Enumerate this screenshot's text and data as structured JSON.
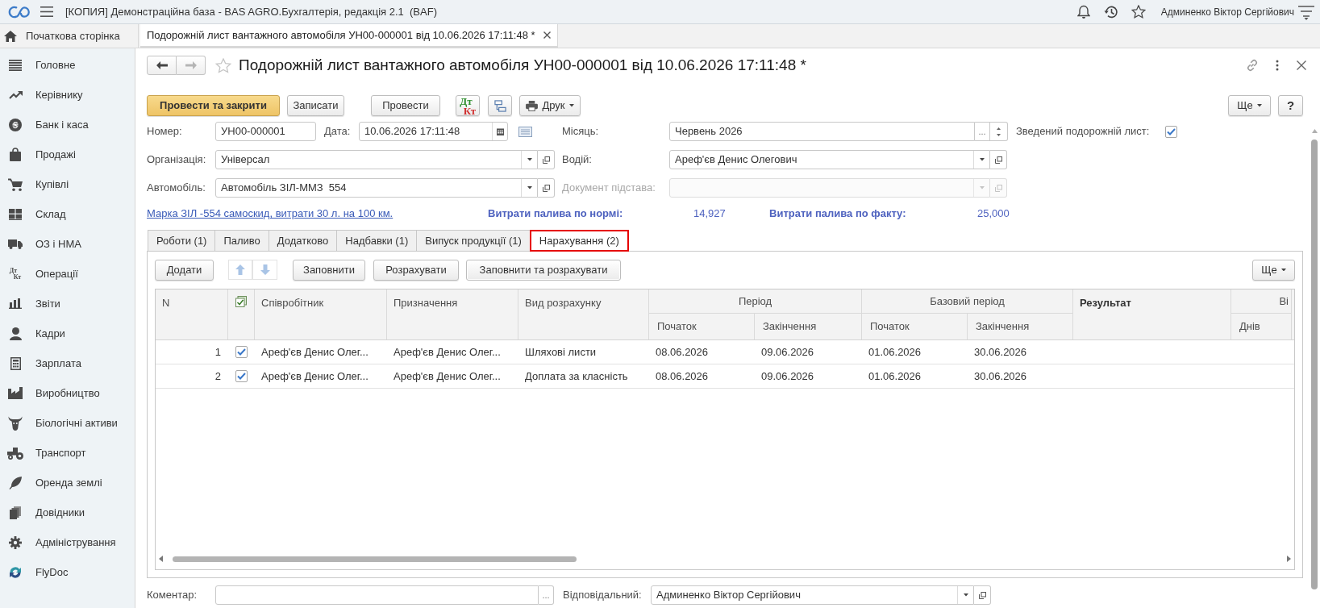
{
  "window": {
    "title": "[КОПИЯ] Демонстраційна база - BAS AGRO.Бухгалтерія, редакція 2.1  (BAF)",
    "user": "Админенко Віктор Сергійович"
  },
  "open_tabs": [
    {
      "kind": "home",
      "label": "Початкова сторінка",
      "selected": false
    },
    {
      "kind": "document",
      "label": "Подорожній лист вантажного автомобіля УН00-000001 від 10.06.2026 17:11:48 *",
      "selected": true
    }
  ],
  "sidebar": {
    "items": [
      {
        "label": "Головне"
      },
      {
        "label": "Керівнику"
      },
      {
        "label": "Банк і каса"
      },
      {
        "label": "Продажі"
      },
      {
        "label": "Купівлі"
      },
      {
        "label": "Склад"
      },
      {
        "label": "ОЗ і НМА"
      },
      {
        "label": "Операції",
        "icon_text": [
          "Дт",
          "Кт"
        ]
      },
      {
        "label": "Звіти"
      },
      {
        "label": "Кадри"
      },
      {
        "label": "Зарплата"
      },
      {
        "label": "Виробництво"
      },
      {
        "label": "Біологічні активи"
      },
      {
        "label": "Транспорт"
      },
      {
        "label": "Оренда землі"
      },
      {
        "label": "Довідники"
      },
      {
        "label": "Адміністрування"
      },
      {
        "label": "FlyDoc"
      }
    ]
  },
  "document": {
    "title": "Подорожній лист вантажного автомобіля УН00-000001 від 10.06.2026 17:11:48 *",
    "commands": [
      {
        "kind": "primary",
        "label": "Провести та закрити"
      },
      {
        "kind": "text",
        "label": "Записати"
      },
      {
        "kind": "text",
        "label": "Провести"
      },
      {
        "kind": "debit_credit",
        "letters": [
          "Дт",
          "Кт"
        ]
      },
      {
        "kind": "structure"
      },
      {
        "kind": "print",
        "label": "Друк"
      }
    ],
    "more": "Ще",
    "help": "?",
    "fields": {
      "number": {
        "label": "Номер:",
        "value": "УН00-000001"
      },
      "date": {
        "label": "Дата:",
        "value": "10.06.2026 17:11:48"
      },
      "month": {
        "label": "Місяць:",
        "value": "Червень 2026",
        "choice_button": "..."
      },
      "summary": {
        "label": "Зведений подорожній лист:",
        "checked": true
      },
      "organization": {
        "label": "Організація:",
        "value": "Універсал",
        "disabled": false
      },
      "driver": {
        "label": "Водій:",
        "value": "Ареф'єв Денис Олегович",
        "disabled": false
      },
      "vehicle": {
        "label": "Автомобіль:",
        "value": "Автомобіль ЗІЛ-ММЗ  554",
        "disabled": false
      },
      "basis_document": {
        "label": "Документ підстава:",
        "disabled": true
      }
    },
    "info": {
      "link": "Марка ЗІЛ -554 самоскид, витрати 30 л. на 100 км.",
      "norm_label": "Витрати палива по нормі:",
      "norm_value": "14,927",
      "fact_label": "Витрати палива по факту:",
      "fact_value": "25,000"
    },
    "tabs": [
      {
        "label": "Роботи (1)",
        "selected": false
      },
      {
        "label": "Паливо",
        "selected": false
      },
      {
        "label": "Додатково",
        "selected": false
      },
      {
        "label": "Надбавки (1)",
        "selected": false
      },
      {
        "label": "Випуск продукції (1)",
        "selected": false
      },
      {
        "label": "Нарахування (2)",
        "selected": true
      }
    ],
    "table_toolbar": {
      "buttons": [
        {
          "kind": "text",
          "label": "Додати",
          "disabled": false
        },
        {
          "kind": "move_up",
          "disabled": true
        },
        {
          "kind": "move_down",
          "disabled": true
        },
        {
          "kind": "text",
          "label": "Заповнити",
          "disabled": false
        },
        {
          "kind": "text",
          "label": "Розрахувати",
          "disabled": false
        },
        {
          "kind": "default",
          "label": "Заповнити та розрахувати",
          "disabled": false
        }
      ],
      "more": "Ще"
    },
    "table": {
      "columns": [
        {
          "kind": "number",
          "label": "N",
          "grouped": false
        },
        {
          "kind": "check",
          "grouped": false
        },
        {
          "kind": "text",
          "label": "Співробітник",
          "grouped": false
        },
        {
          "kind": "text",
          "label": "Призначення",
          "grouped": false
        },
        {
          "kind": "text",
          "label": "Вид розрахунку",
          "grouped": false
        },
        {
          "kind": "text",
          "group_label": "Період",
          "label": "Початок",
          "grouped": true
        },
        {
          "kind": "text",
          "label": "Закінчення",
          "grouped": true
        },
        {
          "kind": "text",
          "group_label": "Базовий період",
          "label": "Початок",
          "grouped": true
        },
        {
          "kind": "text",
          "label": "Закінчення",
          "grouped": true
        },
        {
          "kind": "total",
          "label": "Результат",
          "grouped": false
        },
        {
          "kind": "text",
          "group_label": "Ві",
          "label": "Днів",
          "grouped": true
        }
      ],
      "rows": [
        {
          "checked": true,
          "cells": [
            "1",
            "",
            "Ареф'єв Денис Олег...",
            "Ареф'єв Денис Олег...",
            "Шляхові листи",
            "08.06.2026",
            "09.06.2026",
            "01.06.2026",
            "30.06.2026"
          ]
        },
        {
          "checked": true,
          "cells": [
            "2",
            "",
            "Ареф'єв Денис Олег...",
            "Ареф'єв Денис Олег...",
            "Доплата за класність",
            "08.06.2026",
            "09.06.2026",
            "01.06.2026",
            "30.06.2026"
          ]
        }
      ]
    },
    "footer": {
      "comment": {
        "label": "Коментар:",
        "choice_button": "..."
      },
      "responsible": {
        "label": "Відповідальний:",
        "value": "Админенко Віктор Сергійович",
        "disabled": false
      }
    }
  }
}
